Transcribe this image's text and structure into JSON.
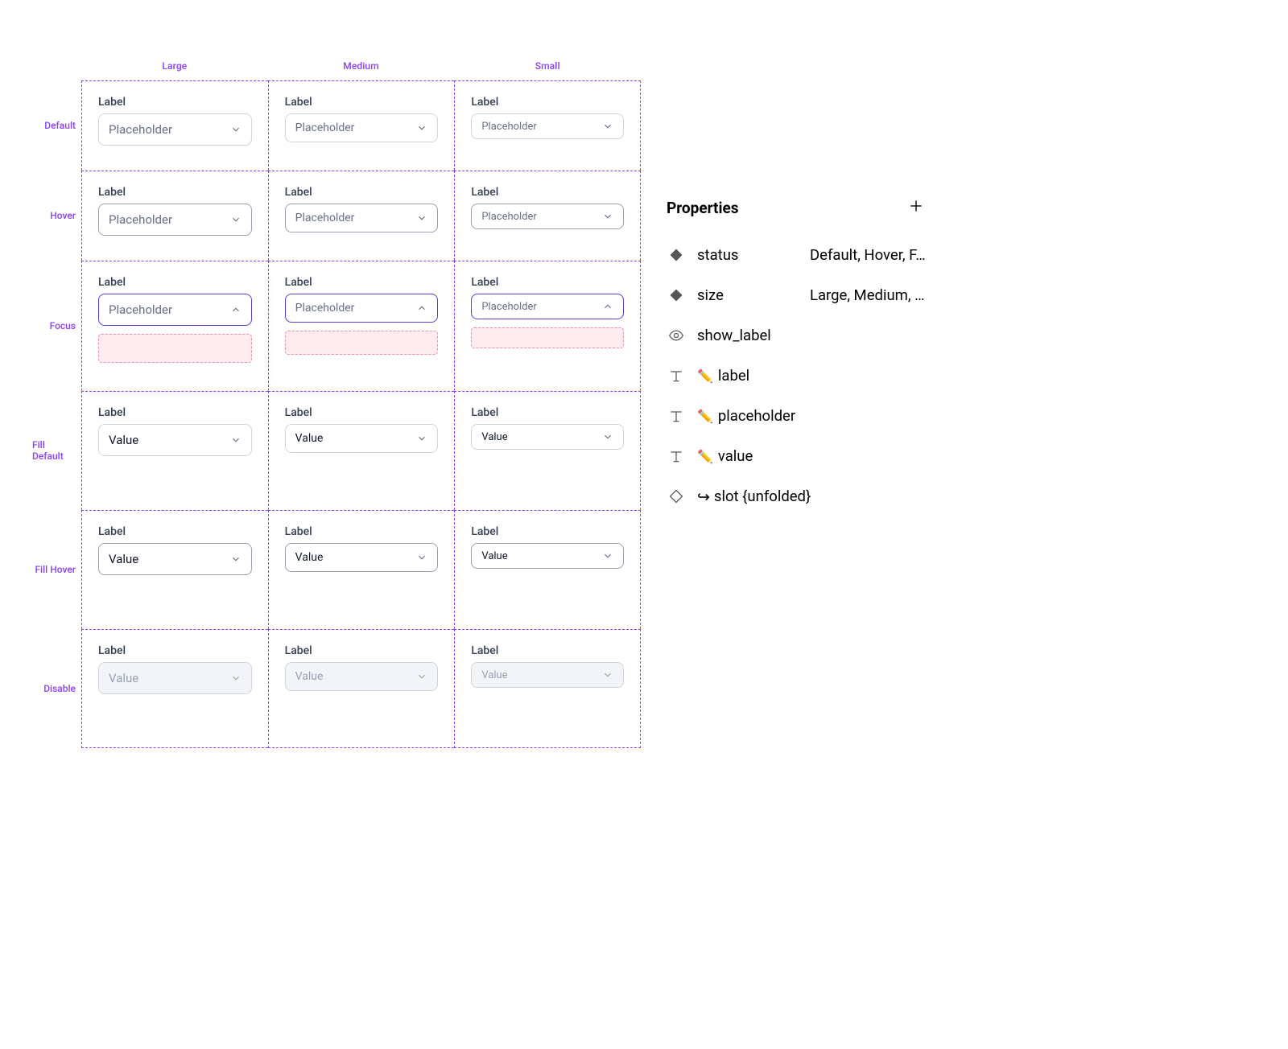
{
  "grid": {
    "columns": [
      "Large",
      "Medium",
      "Small"
    ],
    "rows": [
      "Default",
      "Hover",
      "Focus",
      "Fill Default",
      "Fill Hover",
      "Disable"
    ],
    "label_text": "Label",
    "placeholder_text": "Placeholder",
    "value_text": "Value"
  },
  "panel": {
    "title": "Properties",
    "items": [
      {
        "type": "variant",
        "name": "status",
        "value": "Default, Hover, F..."
      },
      {
        "type": "variant",
        "name": "size",
        "value": "Large, Medium, ..."
      },
      {
        "type": "bool",
        "name": "show_label",
        "value": ""
      },
      {
        "type": "text",
        "name": "label",
        "value": "",
        "editable": true
      },
      {
        "type": "text",
        "name": "placeholder",
        "value": "",
        "editable": true
      },
      {
        "type": "text",
        "name": "value",
        "value": "",
        "editable": true
      },
      {
        "type": "slot",
        "name": "slot {unfolded}",
        "value": "",
        "swap": true
      }
    ]
  }
}
